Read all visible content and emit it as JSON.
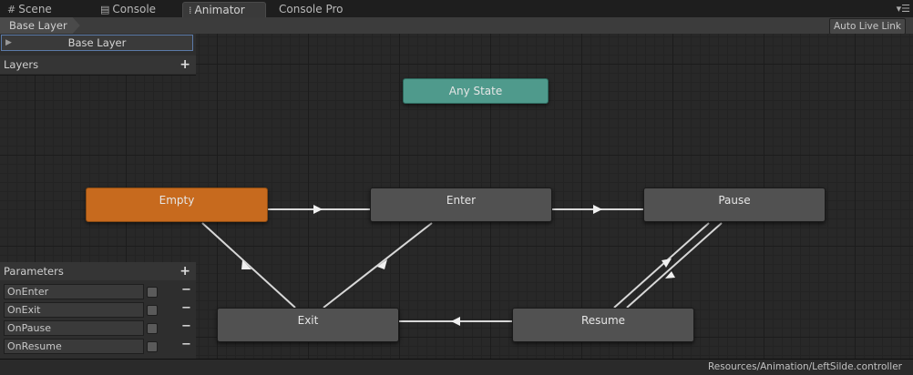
{
  "tabs": [
    {
      "label": "Scene",
      "icon": "grid-icon"
    },
    {
      "label": "Console",
      "icon": "console-icon"
    },
    {
      "label": "Animator",
      "icon": "animator-icon"
    },
    {
      "label": "Console Pro",
      "icon": ""
    }
  ],
  "toolbar": {
    "breadcrumb": "Base Layer",
    "auto_live_link": "Auto Live Link"
  },
  "layers_panel": {
    "layer_name": "Base Layer",
    "header": "Layers"
  },
  "parameters_panel": {
    "header": "Parameters",
    "params": [
      {
        "name": "OnEnter",
        "checked": false
      },
      {
        "name": "OnExit",
        "checked": false
      },
      {
        "name": "OnPause",
        "checked": false
      },
      {
        "name": "OnResume",
        "checked": false
      }
    ]
  },
  "states": [
    {
      "id": "any",
      "label": "Any State",
      "kind": "any"
    },
    {
      "id": "empty",
      "label": "Empty",
      "kind": "default"
    },
    {
      "id": "enter",
      "label": "Enter",
      "kind": "normal"
    },
    {
      "id": "pause",
      "label": "Pause",
      "kind": "normal"
    },
    {
      "id": "exit",
      "label": "Exit",
      "kind": "normal"
    },
    {
      "id": "resume",
      "label": "Resume",
      "kind": "normal"
    }
  ],
  "transitions": [
    {
      "from": "empty",
      "to": "enter"
    },
    {
      "from": "enter",
      "to": "pause"
    },
    {
      "from": "exit",
      "to": "empty"
    },
    {
      "from": "enter",
      "to": "exit"
    },
    {
      "from": "resume",
      "to": "exit"
    },
    {
      "from": "pause",
      "to": "resume"
    },
    {
      "from": "resume",
      "to": "pause"
    }
  ],
  "status": {
    "path": "Resources/Animation/LeftSilde.controller"
  },
  "colors": {
    "default_state": "#c76a1e",
    "any_state": "#4f9a8c",
    "normal_state": "#515151",
    "selection": "#5b7aa8"
  }
}
